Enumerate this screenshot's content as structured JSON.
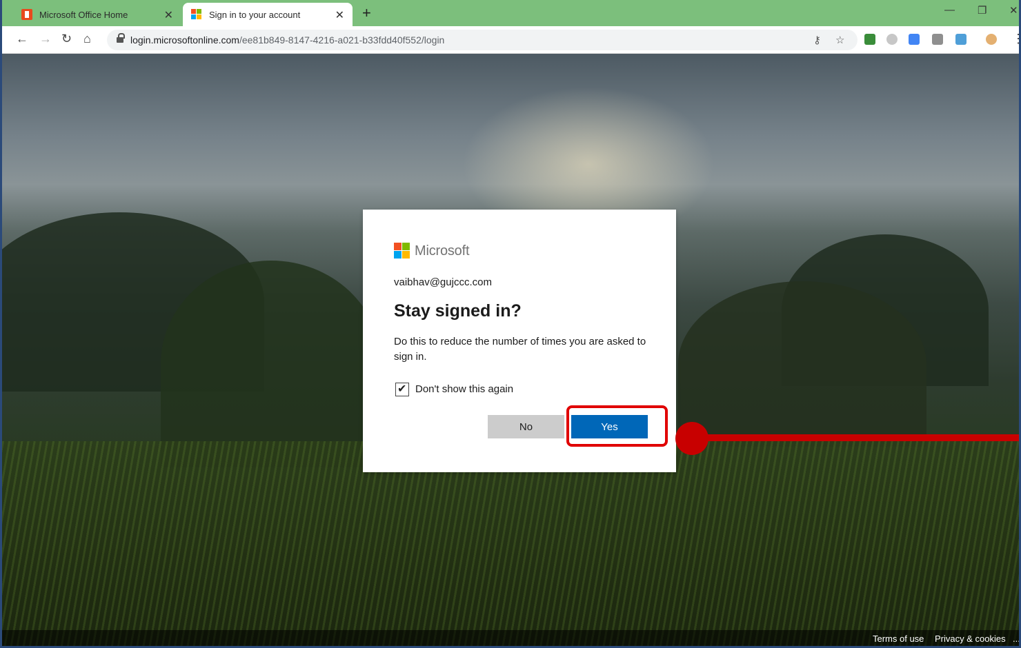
{
  "browser": {
    "tabs": [
      {
        "title": "Microsoft Office Home",
        "active": false
      },
      {
        "title": "Sign in to your account",
        "active": true
      }
    ],
    "url_host": "login.microsoftonline.com",
    "url_path": "/ee81b849-8147-4216-a021-b33fdd40f552/login"
  },
  "card": {
    "brand": "Microsoft",
    "email": "vaibhav@gujccc.com",
    "heading": "Stay signed in?",
    "description": "Do this to reduce the number of times you are asked to sign in.",
    "checkbox_label": "Don't show this again",
    "checkbox_checked": true,
    "no_label": "No",
    "yes_label": "Yes"
  },
  "footer": {
    "terms": "Terms of use",
    "privacy": "Privacy & cookies",
    "more": "..."
  },
  "colors": {
    "tabstrip": "#7cbf7c",
    "primary_button": "#0067b8",
    "highlight": "#e00000"
  }
}
